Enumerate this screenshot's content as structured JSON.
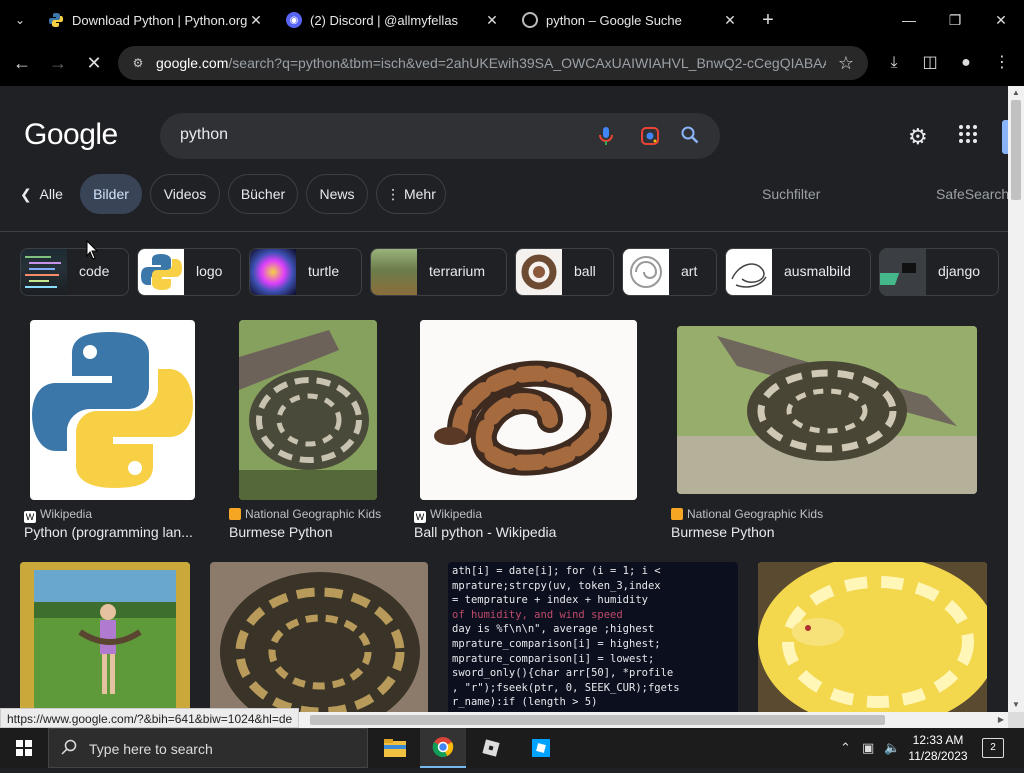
{
  "tabs": [
    {
      "title": "Download Python | Python.org",
      "favicon": "python-icon"
    },
    {
      "title": "(2) Discord | @allmyfellas",
      "favicon": "discord-icon"
    },
    {
      "title": "python – Google Suche",
      "favicon": "google-icon"
    }
  ],
  "omnibox": {
    "host": "google.com",
    "path": "/search?q=python&tbm=isch&ved=2ahUKEwih39SA_OWCAxUAIWIAHVL_BnwQ2-cCegQIABAA..."
  },
  "google": {
    "logo": "Google",
    "query": "python",
    "nav": {
      "back_label": "Alle",
      "items": [
        "Bilder",
        "Videos",
        "Bücher",
        "News"
      ],
      "more_label": "Mehr",
      "filters_label": "Suchfilter",
      "safesearch_label": "SafeSearch"
    }
  },
  "chips": [
    "code",
    "logo",
    "turtle",
    "terrarium",
    "ball",
    "art",
    "ausmalbild",
    "django"
  ],
  "results": [
    {
      "source": "Wikipedia",
      "caption": "Python (programming lan..."
    },
    {
      "source": "National Geographic Kids",
      "caption": "Burmese Python"
    },
    {
      "source": "Wikipedia",
      "caption": "Ball python - Wikipedia"
    },
    {
      "source": "National Geographic Kids",
      "caption": "Burmese Python"
    }
  ],
  "code_lines": [
    "ath[i] = date[i]; for (i = 1; i <",
    "mprature;strcpy(uv, token_3,index",
    "= temprature + index + humidity",
    "of humidity, and wind speed",
    "day is %f\\n\\n\", average ;highest",
    "mprature_comparison[i] = highest;",
    "mprature_comparison[i] = lowest;",
    "sword_only(){char arr[50], *profile",
    ", \"r\");fseek(ptr, 0, SEEK_CUR);fgets",
    "r_name):if (length > 5)"
  ],
  "status_url": "https://www.google.com/?&bih=641&biw=1024&hl=de",
  "taskbar": {
    "search_placeholder": "Type here to search",
    "time": "12:33 AM",
    "date": "11/28/2023",
    "notifications": "2"
  },
  "colors": {
    "page_bg": "#202124",
    "active_chip": "#394457",
    "accent": "#8ab4f8"
  }
}
